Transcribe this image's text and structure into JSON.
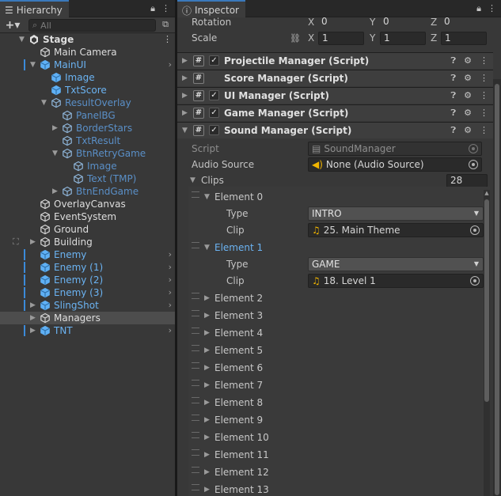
{
  "hierarchy": {
    "tab_title": "Hierarchy",
    "search_placeholder": "All",
    "rows": [
      {
        "label": "Stage",
        "depth": 0,
        "style": "bold",
        "fold": "open",
        "icon": "unity-scene-icon",
        "menu": true
      },
      {
        "label": "Main Camera",
        "depth": 1,
        "style": "white",
        "icon": "gameobject-icon"
      },
      {
        "label": "MainUI",
        "depth": 1,
        "style": "blue",
        "fold": "open",
        "icon": "prefab-icon",
        "mark": true,
        "chevron": true
      },
      {
        "label": "Image",
        "depth": 2,
        "style": "blue",
        "icon": "prefab-child-icon"
      },
      {
        "label": "TxtScore",
        "depth": 2,
        "style": "blue",
        "icon": "prefab-child-icon"
      },
      {
        "label": "ResultOverlay",
        "depth": 2,
        "style": "blue2",
        "fold": "open",
        "icon": "prefab-child-icon"
      },
      {
        "label": "PanelBG",
        "depth": 3,
        "style": "blue2",
        "icon": "prefab-child-icon"
      },
      {
        "label": "BorderStars",
        "depth": 3,
        "style": "blue2",
        "fold": "closed",
        "icon": "prefab-child-icon"
      },
      {
        "label": "TxtResult",
        "depth": 3,
        "style": "blue2",
        "icon": "prefab-child-icon"
      },
      {
        "label": "BtnRetryGame",
        "depth": 3,
        "style": "blue2",
        "fold": "open",
        "icon": "prefab-child-icon"
      },
      {
        "label": "Image",
        "depth": 4,
        "style": "blue2",
        "icon": "prefab-child-icon"
      },
      {
        "label": "Text (TMP)",
        "depth": 4,
        "style": "blue2",
        "icon": "prefab-child-icon"
      },
      {
        "label": "BtnEndGame",
        "depth": 3,
        "style": "blue2",
        "fold": "closed",
        "icon": "prefab-child-icon"
      },
      {
        "label": "OverlayCanvas",
        "depth": 1,
        "style": "white",
        "icon": "gameobject-icon"
      },
      {
        "label": "EventSystem",
        "depth": 1,
        "style": "white",
        "icon": "gameobject-icon"
      },
      {
        "label": "Ground",
        "depth": 1,
        "style": "white",
        "icon": "gameobject-icon"
      },
      {
        "label": "Building",
        "depth": 1,
        "style": "white",
        "fold": "closed",
        "icon": "gameobject-icon",
        "side": true
      },
      {
        "label": "Enemy",
        "depth": 1,
        "style": "blue",
        "icon": "prefab-icon",
        "mark": true,
        "chevron": true
      },
      {
        "label": "Enemy (1)",
        "depth": 1,
        "style": "blue",
        "icon": "prefab-icon",
        "mark": true,
        "chevron": true
      },
      {
        "label": "Enemy (2)",
        "depth": 1,
        "style": "blue",
        "icon": "prefab-icon",
        "mark": true,
        "chevron": true
      },
      {
        "label": "Enemy (3)",
        "depth": 1,
        "style": "blue",
        "icon": "prefab-icon",
        "mark": true,
        "chevron": true
      },
      {
        "label": "SlingShot",
        "depth": 1,
        "style": "blue",
        "fold": "closed",
        "icon": "prefab-icon",
        "mark": true,
        "chevron": true
      },
      {
        "label": "Managers",
        "depth": 1,
        "style": "white",
        "fold": "closed",
        "icon": "gameobject-icon",
        "selected": true
      },
      {
        "label": "TNT",
        "depth": 1,
        "style": "blue",
        "fold": "closed",
        "icon": "prefab-icon",
        "mark": true,
        "chevron": true
      }
    ]
  },
  "inspector": {
    "tab_title": "Inspector",
    "rotation": {
      "label": "Rotation",
      "x": "0",
      "y": "0",
      "z": "0"
    },
    "scale": {
      "label": "Scale",
      "x": "1",
      "y": "1",
      "z": "1"
    },
    "axis": {
      "x": "X",
      "y": "Y",
      "z": "Z"
    },
    "components": [
      {
        "title": "Projectile Manager (Script)",
        "checkbox": true,
        "fold": "closed"
      },
      {
        "title": "Score Manager (Script)",
        "checkbox": false,
        "fold": "closed"
      },
      {
        "title": "UI Manager (Script)",
        "checkbox": true,
        "fold": "closed"
      },
      {
        "title": "Game Manager (Script)",
        "checkbox": true,
        "fold": "closed"
      },
      {
        "title": "Sound Manager (Script)",
        "checkbox": true,
        "fold": "open"
      }
    ],
    "sound_manager": {
      "script_label": "Script",
      "script_value": "SoundManager",
      "audio_label": "Audio Source",
      "audio_value": "None (Audio Source)",
      "clips_label": "Clips",
      "clips_count": "28",
      "type_label": "Type",
      "clip_label": "Clip",
      "elements": [
        {
          "label": "Element 0",
          "open": true,
          "type": "INTRO",
          "clip": "25. Main Theme"
        },
        {
          "label": "Element 1",
          "open": true,
          "highlight": true,
          "type": "GAME",
          "clip": "18. Level 1"
        },
        {
          "label": "Element 2"
        },
        {
          "label": "Element 3"
        },
        {
          "label": "Element 4"
        },
        {
          "label": "Element 5"
        },
        {
          "label": "Element 6"
        },
        {
          "label": "Element 7"
        },
        {
          "label": "Element 8"
        },
        {
          "label": "Element 9"
        },
        {
          "label": "Element 10"
        },
        {
          "label": "Element 11"
        },
        {
          "label": "Element 12"
        },
        {
          "label": "Element 13"
        }
      ]
    }
  }
}
